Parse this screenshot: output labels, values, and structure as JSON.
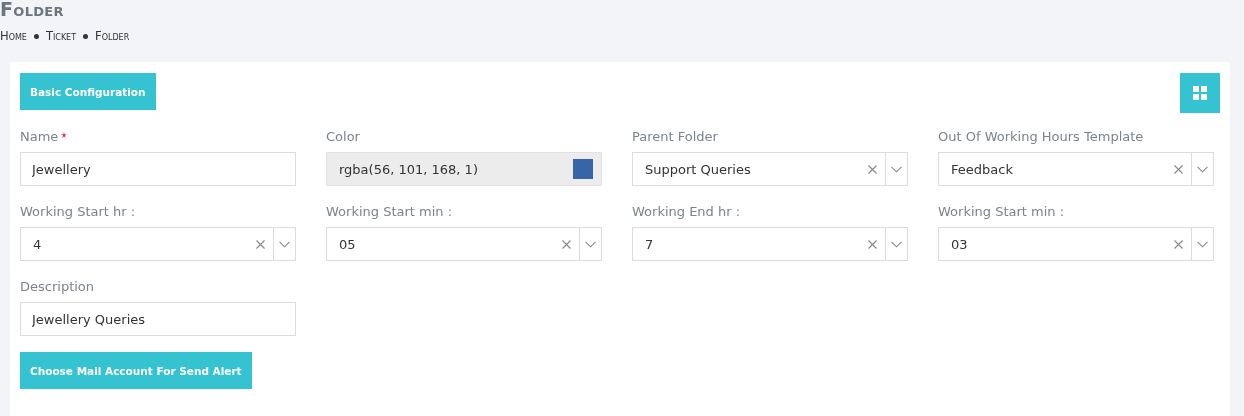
{
  "page": {
    "title": "Folder"
  },
  "breadcrumb": [
    "Home",
    "Ticket",
    "Folder"
  ],
  "section_button": "Basic Configuration",
  "fields": [
    {
      "label": "Name",
      "kind": "text",
      "required": true,
      "value": "Jewellery"
    },
    {
      "label": "Color",
      "kind": "color",
      "required": false,
      "value": "rgba(56, 101, 168, 1)",
      "color": "#3865a8"
    },
    {
      "label": "Parent Folder",
      "kind": "select",
      "required": false,
      "value": "Support Queries"
    },
    {
      "label": "Out Of Working Hours Template",
      "kind": "select",
      "required": false,
      "value": "Feedback"
    },
    {
      "label": "Working Start hr :",
      "kind": "select",
      "required": false,
      "value": "4"
    },
    {
      "label": "Working Start min :",
      "kind": "select",
      "required": false,
      "value": "05"
    },
    {
      "label": "Working End hr :",
      "kind": "select",
      "required": false,
      "value": "7"
    },
    {
      "label": "Working Start min :",
      "kind": "select",
      "required": false,
      "value": "03"
    },
    {
      "label": "Description",
      "kind": "text",
      "required": false,
      "value": "Jewellery Queries"
    }
  ],
  "alert_button": "Choose Mail Account For Send Alert"
}
